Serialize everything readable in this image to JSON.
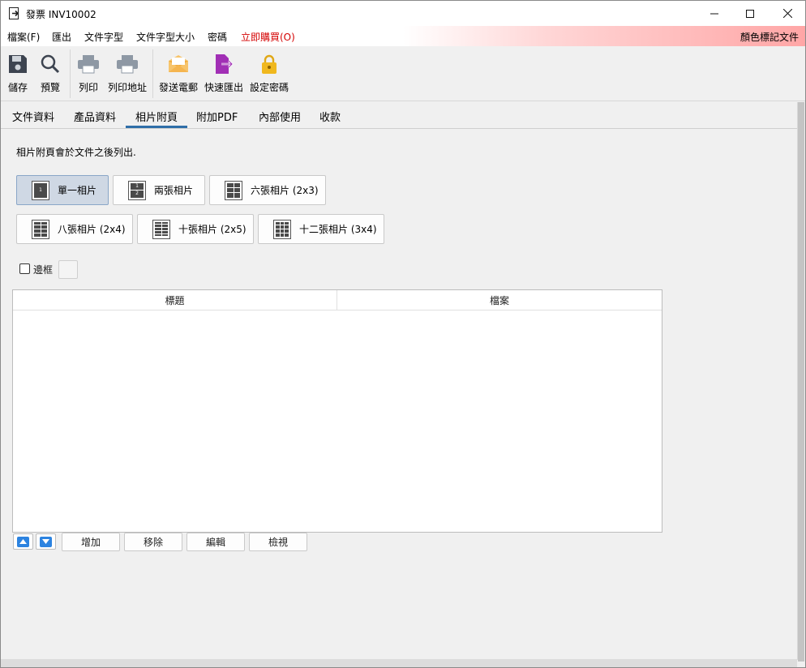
{
  "window": {
    "title": "發票 INV10002"
  },
  "menu": {
    "items": [
      "檔案(F)",
      "匯出",
      "文件字型",
      "文件字型大小",
      "密碼",
      "立即購買(O)"
    ],
    "right": "顏色標記文件"
  },
  "toolbar": {
    "items": [
      {
        "label": "儲存",
        "icon": "save-icon"
      },
      {
        "label": "預覽",
        "icon": "search-icon"
      },
      {
        "label": "列印",
        "icon": "printer-icon"
      },
      {
        "label": "列印地址",
        "icon": "printer-icon"
      },
      {
        "label": "發送電郵",
        "icon": "envelope-icon"
      },
      {
        "label": "快速匯出",
        "icon": "export-icon"
      },
      {
        "label": "設定密碼",
        "icon": "lock-icon"
      }
    ]
  },
  "tabs": [
    "文件資料",
    "產品資料",
    "相片附頁",
    "附加PDF",
    "內部使用",
    "收款"
  ],
  "active_tab": "相片附頁",
  "note": "相片附頁會於文件之後列出.",
  "layouts": [
    {
      "label": "單一相片",
      "active": true
    },
    {
      "label": "兩張相片",
      "active": false
    },
    {
      "label": "六張相片 (2x3)",
      "active": false
    },
    {
      "label": "八張相片 (2x4)",
      "active": false
    },
    {
      "label": "十張相片 (2x5)",
      "active": false
    },
    {
      "label": "十二張相片 (3x4)",
      "active": false
    }
  ],
  "border_checkbox": {
    "label": "邊框",
    "checked": false
  },
  "table": {
    "columns": [
      "標題",
      "檔案"
    ],
    "rows": []
  },
  "actions": [
    "增加",
    "移除",
    "編輯",
    "檢視"
  ],
  "colors": {
    "accent": "#2f6ea8",
    "buy": "#d40000",
    "arrow": "#2c83e0"
  }
}
